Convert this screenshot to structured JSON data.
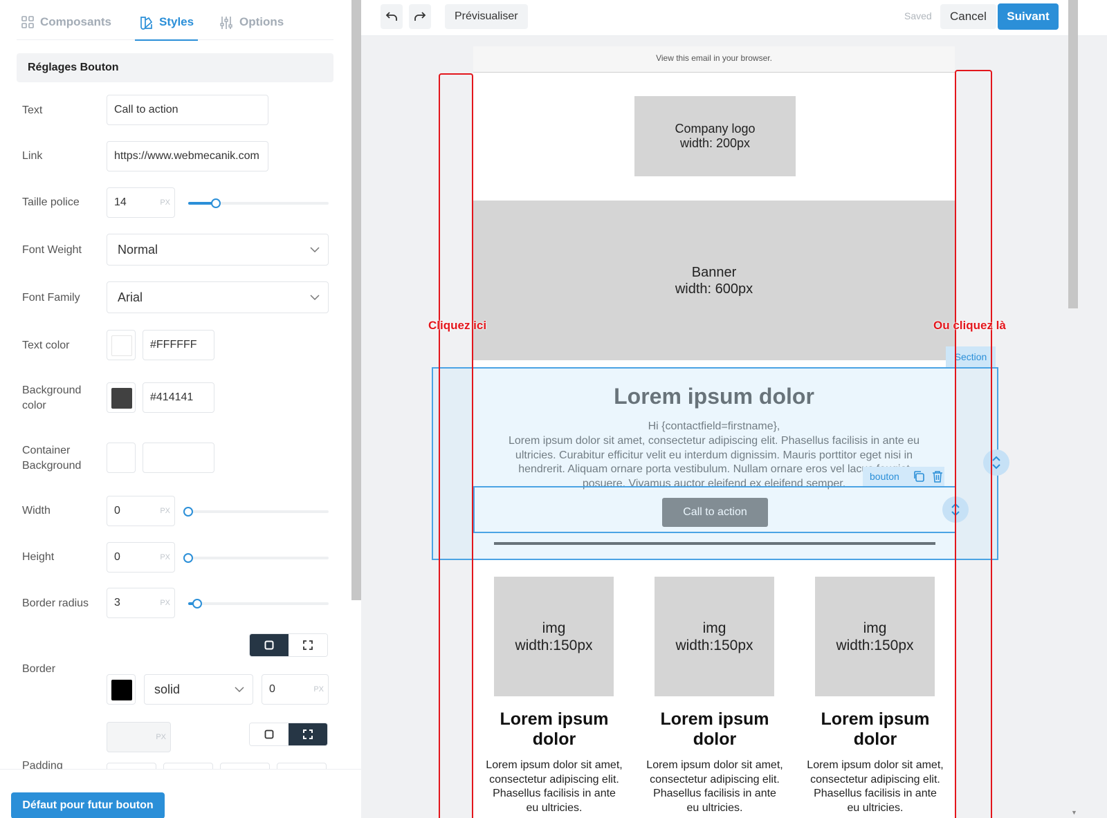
{
  "tabs": [
    {
      "label": "Composants",
      "icon": "grid-icon",
      "active": false
    },
    {
      "label": "Styles",
      "icon": "paint-icon",
      "active": true
    },
    {
      "label": "Options",
      "icon": "sliders-icon",
      "active": false
    }
  ],
  "settings": {
    "title": "Réglages Bouton",
    "text_label": "Text",
    "text_value": "Call to action",
    "link_label": "Link",
    "link_value": "https://www.webmecanik.com",
    "font_size_label": "Taille police",
    "font_size_value": "14",
    "font_size_fraction": 0.17,
    "unit": "PX",
    "font_weight_label": "Font Weight",
    "font_weight_value": "Normal",
    "font_family_label": "Font Family",
    "font_family_value": "Arial",
    "text_color_label": "Text color",
    "text_color_value": "#FFFFFF",
    "bg_color_label": "Background color",
    "bg_color_value": "#414141",
    "container_bg_label": "Container Background",
    "container_bg_value": "",
    "width_label": "Width",
    "width_value": "0",
    "height_label": "Height",
    "height_value": "0",
    "radius_label": "Border radius",
    "radius_value": "3",
    "radius_fraction": 0.04,
    "border_label": "Border",
    "border_color_value": "#000000",
    "border_style_value": "solid",
    "border_width_value": "0",
    "padding_label": "Padding",
    "default_button_label": "Défaut pour futur bouton"
  },
  "toolbar": {
    "undo_icon": "undo-icon",
    "redo_icon": "redo-icon",
    "preview_label": "Prévisualiser",
    "saved_label": "Saved",
    "cancel_label": "Cancel",
    "next_label": "Suivant"
  },
  "email": {
    "browser_link": "View this email in your browser.",
    "logo_line1": "Company logo",
    "logo_line2": "width: 200px",
    "banner_line1": "Banner",
    "banner_line2": "width: 600px",
    "heading": "Lorem ipsum dolor",
    "greeting": "Hi {contactfield=firstname},",
    "body": "Lorem ipsum dolor sit amet, consectetur adipiscing elit. Phasellus facilisis in ante eu ultricies. Curabitur efficitur velit eu interdum dignissim. Mauris porttitor eget nisi in hendrerit. Aliquam ornare porta vestibulum. Nullam ornare eros vel lacus feugiat posuere. Vivamus auctor eleifend ex eleifend semper.",
    "cta_label": "Call to action",
    "columns": [
      {
        "img_line1": "img",
        "img_line2": "width:150px",
        "title": "Lorem ipsum dolor",
        "body": "Lorem ipsum dolor sit amet, consectetur adipiscing elit. Phasellus facilisis in ante eu ultricies."
      },
      {
        "img_line1": "img",
        "img_line2": "width:150px",
        "title": "Lorem ipsum dolor",
        "body": "Lorem ipsum dolor sit amet, consectetur adipiscing elit. Phasellus facilisis in ante eu ultricies."
      },
      {
        "img_line1": "img",
        "img_line2": "width:150px",
        "title": "Lorem ipsum dolor",
        "body": "Lorem ipsum dolor sit amet, consectetur adipiscing elit. Phasellus facilisis in ante eu ultricies."
      }
    ]
  },
  "overlay": {
    "left_annotation": "Cliquez ici",
    "right_annotation": "Ou cliquez là",
    "section_tag": "Section",
    "button_tag": "bouton",
    "annotation_color": "#e3161c",
    "selection_color": "#4aa3e4"
  }
}
